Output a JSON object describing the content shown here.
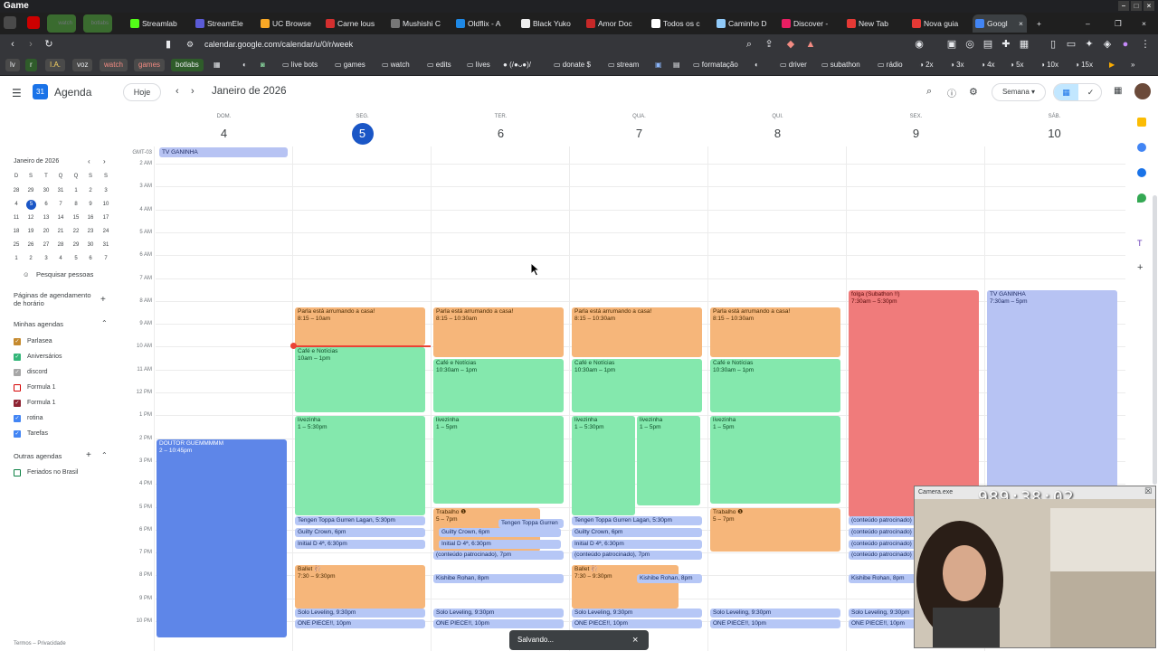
{
  "titlebar": {
    "title": "Game"
  },
  "tabs": [
    {
      "label": "watch",
      "hl": true
    },
    {
      "label": "botlabs",
      "hl": true
    },
    {
      "label": "Streamlab"
    },
    {
      "label": "StreamEle"
    },
    {
      "label": "UC Browse"
    },
    {
      "label": "Carne lous"
    },
    {
      "label": "Mushishi C"
    },
    {
      "label": "Oldflix - A"
    },
    {
      "label": "Black Yuko"
    },
    {
      "label": "Amor Doc"
    },
    {
      "label": "Todos os c"
    },
    {
      "label": "Caminho D"
    },
    {
      "label": "Discover -"
    },
    {
      "label": "New Tab"
    },
    {
      "label": "Nova guia"
    },
    {
      "label": "Googl"
    }
  ],
  "url": "calendar.google.com/calendar/u/0/r/week",
  "bookmarks": [
    {
      "label": "lv"
    },
    {
      "label": "r"
    },
    {
      "label": "I.A."
    },
    {
      "label": "voz"
    },
    {
      "label": "watch"
    },
    {
      "label": "games"
    },
    {
      "label": "botlabs"
    },
    {
      "label": "live bots"
    },
    {
      "label": "games"
    },
    {
      "label": "watch"
    },
    {
      "label": "edits"
    },
    {
      "label": "lives"
    },
    {
      "label": "(/●ᴗ●)/"
    },
    {
      "label": "donate $"
    },
    {
      "label": "stream"
    },
    {
      "label": "formatação"
    },
    {
      "label": "driver"
    },
    {
      "label": "subathon"
    },
    {
      "label": "rádio"
    },
    {
      "label": "2x"
    },
    {
      "label": "3x"
    },
    {
      "label": "4x"
    },
    {
      "label": "5x"
    },
    {
      "label": "10x"
    },
    {
      "label": "15x"
    }
  ],
  "header": {
    "app_name": "Agenda",
    "today_btn": "Hoje",
    "month": "Janeiro de 2026",
    "view": "Semana"
  },
  "sidebar": {
    "mini_title": "Janeiro de 2026",
    "weekdays": [
      "D",
      "S",
      "T",
      "Q",
      "Q",
      "S",
      "S"
    ],
    "weeks": [
      [
        "28",
        "29",
        "30",
        "31",
        "1",
        "2",
        "3"
      ],
      [
        "4",
        "5",
        "6",
        "7",
        "8",
        "9",
        "10"
      ],
      [
        "11",
        "12",
        "13",
        "14",
        "15",
        "16",
        "17"
      ],
      [
        "18",
        "19",
        "20",
        "21",
        "22",
        "23",
        "24"
      ],
      [
        "25",
        "26",
        "27",
        "28",
        "29",
        "30",
        "31"
      ],
      [
        "1",
        "2",
        "3",
        "4",
        "5",
        "6",
        "7"
      ]
    ],
    "search_people": "Pesquisar pessoas",
    "booking_pages": "Páginas de agendamento de horário",
    "my_calendars": "Minhas agendas",
    "my_items": [
      {
        "label": "Parlasea",
        "color": "#c58a2e",
        "checked": true
      },
      {
        "label": "Aniversários",
        "color": "#33b679",
        "checked": true
      },
      {
        "label": "discord",
        "color": "#a6a6a6",
        "checked": true
      },
      {
        "label": "Formula 1",
        "color": "#d50000",
        "checked": false
      },
      {
        "label": "Formula 1",
        "color": "#8e2433",
        "checked": true
      },
      {
        "label": "rotina",
        "color": "#4285f4",
        "checked": true
      },
      {
        "label": "Tarefas",
        "color": "#4285f4",
        "checked": true
      }
    ],
    "other_calendars": "Outras agendas",
    "other_items": [
      {
        "label": "Feriados no Brasil",
        "color": "#0b8043",
        "checked": false
      }
    ],
    "footer": "Termos – Privacidade"
  },
  "days": [
    {
      "dow": "DOM.",
      "num": "4"
    },
    {
      "dow": "SEG.",
      "num": "5"
    },
    {
      "dow": "TER.",
      "num": "6"
    },
    {
      "dow": "QUA.",
      "num": "7"
    },
    {
      "dow": "QUI.",
      "num": "8"
    },
    {
      "dow": "SEX.",
      "num": "9"
    },
    {
      "dow": "SÁB.",
      "num": "10"
    }
  ],
  "timezone": "GMT-03",
  "hours": [
    "2 AM",
    "3 AM",
    "4 AM",
    "5 AM",
    "6 AM",
    "7 AM",
    "8 AM",
    "9 AM",
    "10 AM",
    "11 AM",
    "12 PM",
    "1 PM",
    "2 PM",
    "3 PM",
    "4 PM",
    "5 PM",
    "6 PM",
    "7 PM",
    "8 PM",
    "9 PM",
    "10 PM"
  ],
  "allday": "TV GANINHA",
  "events": {
    "doutor": {
      "t": "DOUTOR GUEMMMMM",
      "s": "2 – 10:45pm"
    },
    "parla": {
      "t": "Parla está arrumando a casa!",
      "s1": "8:15 – 10am",
      "s2": "8:15 – 10:30am"
    },
    "cafe": {
      "t": "Café e Notícias",
      "s1": "10am – 1pm",
      "s2": "10:30am – 1pm"
    },
    "live": {
      "t": "livezinha",
      "s1": "1 – 5:30pm",
      "s2": "1 – 5pm"
    },
    "trabalho": {
      "t": "Trabalho ❶",
      "s": "5 – 7pm"
    },
    "tengen": {
      "t": "Tengen Toppa Gurren Lagan, 5:30pm",
      "short": "Tengen Toppa Gurren"
    },
    "guilty": {
      "t": "Guilty Crown, 6pm"
    },
    "initial": {
      "t": "Initial D 4ª, 6:30pm"
    },
    "patro": {
      "t": "(conteúdo patrocinado), 7pm",
      "short": "(conteúdo patrocinado)"
    },
    "ballet": {
      "t": "Ballet 🩰",
      "s": "7:30 – 9:30pm"
    },
    "kishibe": {
      "t": "Kishibe Rohan, 8pm"
    },
    "solo": {
      "t": "Solo Leveling, 9:30pm"
    },
    "onepiece": {
      "t": "ONE PIECE!!, 10pm"
    },
    "folga": {
      "t": "folga (Subathon !!)",
      "s": "7:30am – 5:30pm"
    },
    "tv": {
      "t": "TV GANINHA",
      "s": "7:30am – 5pm"
    }
  },
  "webcam": {
    "title": "Camera.exe",
    "timer": "989:38:02"
  },
  "toast": {
    "text": "Salvando..."
  }
}
